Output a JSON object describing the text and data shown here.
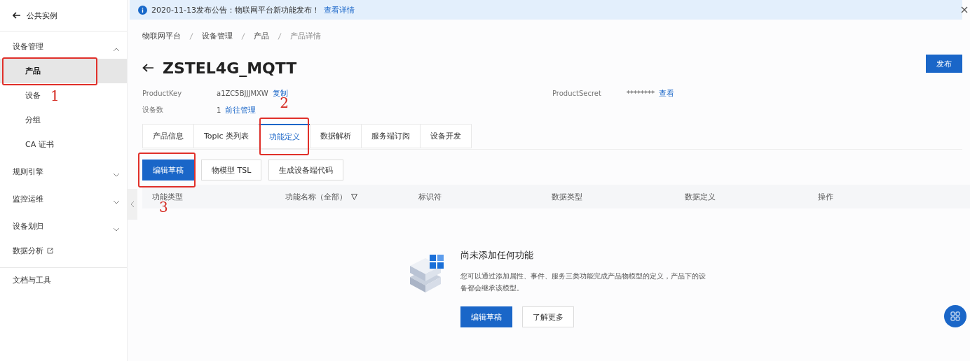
{
  "sidebar": {
    "back": "公共实例",
    "groups": [
      {
        "label": "设备管理",
        "kind": "group",
        "expanded": true,
        "children": [
          {
            "label": "产品",
            "selected": true,
            "annotation": "1"
          },
          {
            "label": "设备",
            "selected": false
          },
          {
            "label": "分组",
            "selected": false
          },
          {
            "label": "CA 证书",
            "selected": false
          }
        ]
      },
      {
        "label": "规则引擎",
        "kind": "group",
        "expanded": false
      },
      {
        "label": "监控运维",
        "kind": "group",
        "expanded": false
      },
      {
        "label": "设备划归",
        "kind": "group",
        "expanded": false
      },
      {
        "label": "数据分析",
        "kind": "external"
      },
      {
        "label": "文档与工具",
        "kind": "section"
      }
    ]
  },
  "notice": {
    "text": "2020-11-13发布公告：物联网平台新功能发布！",
    "link": "查看详情"
  },
  "breadcrumb": [
    "物联网平台",
    "设备管理",
    "产品",
    "产品详情"
  ],
  "title": "ZSTEL4G_MQTT",
  "publish_button": "发布",
  "info": [
    {
      "label": "ProductKey",
      "value": "a1ZC5BJJJMXW",
      "link": "复制"
    },
    {
      "label": "设备数",
      "value": "1",
      "link": "前往管理"
    }
  ],
  "secret": {
    "label": "ProductSecret",
    "value": "********",
    "link": "查看"
  },
  "tabs": [
    {
      "label": "产品信息",
      "selected": false
    },
    {
      "label": "Topic 类列表",
      "selected": false
    },
    {
      "label": "功能定义",
      "selected": true,
      "annotation": "2"
    },
    {
      "label": "数据解析",
      "selected": false
    },
    {
      "label": "服务端订阅",
      "selected": false
    },
    {
      "label": "设备开发",
      "selected": false
    }
  ],
  "actions": [
    {
      "label": "编辑草稿",
      "primary": true,
      "annotation": "3"
    },
    {
      "label": "物模型 TSL",
      "primary": false
    },
    {
      "label": "生成设备端代码",
      "primary": false
    }
  ],
  "table": {
    "columns": [
      {
        "label": "功能类型"
      },
      {
        "label": "功能名称（全部）",
        "filter": true
      },
      {
        "label": "标识符"
      },
      {
        "label": "数据类型"
      },
      {
        "label": "数据定义"
      },
      {
        "label": "操作"
      }
    ]
  },
  "empty": {
    "title": "尚未添加任何功能",
    "text": "您可以通过添加属性、事件、服务三类功能完成产品物模型的定义，产品下的设备都会继承该模型。",
    "buttons": [
      {
        "label": "编辑草稿",
        "primary": true
      },
      {
        "label": "了解更多",
        "primary": false
      }
    ]
  }
}
